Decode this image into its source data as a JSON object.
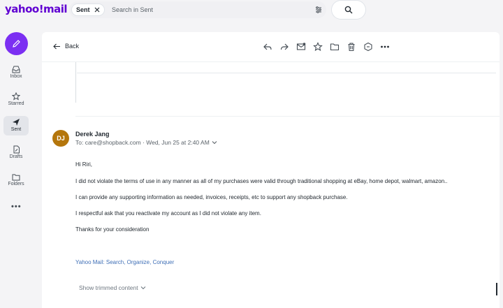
{
  "app": {
    "logo": "yahoo!mail"
  },
  "search": {
    "chip_label": "Sent",
    "placeholder": "Search in Sent"
  },
  "nav": {
    "items": [
      {
        "label": "Inbox",
        "icon": "inbox-icon"
      },
      {
        "label": "Starred",
        "icon": "star-icon"
      },
      {
        "label": "Sent",
        "icon": "send-icon",
        "active": true
      },
      {
        "label": "Drafts",
        "icon": "draft-icon"
      },
      {
        "label": "Folders",
        "icon": "folder-icon"
      }
    ],
    "more": "•••"
  },
  "toolbar": {
    "back_label": "Back",
    "actions": [
      "reply-icon",
      "forward-icon",
      "mark-unread-icon",
      "star-icon",
      "move-folder-icon",
      "delete-icon",
      "spam-icon",
      "more-icon"
    ]
  },
  "message": {
    "avatar_initials": "DJ",
    "sender": "Derek Jang",
    "meta": "To: care@shopback.com · Wed, Jun 25 at 2:40 AM",
    "body": [
      "Hi Riri,",
      "I did not violate the terms of use in any manner as all of my purchases were valid through traditional shopping at eBay,  home depot,  walmart,  amazon..",
      "I can provide any supporting information as needed,  invoices,  receipts,  etc to support any shopback purchase.",
      "I respectful ask that you reactivate my account as I did not violate any item.",
      "Thanks for your consideration"
    ],
    "signature": "Yahoo Mail: Search, Organize, Conquer",
    "show_trimmed": "Show trimmed content"
  },
  "colors": {
    "brand": "#6001d2",
    "compose": "#7b2ff2",
    "avatar": "#b4760c",
    "link": "#3f6fb6"
  }
}
